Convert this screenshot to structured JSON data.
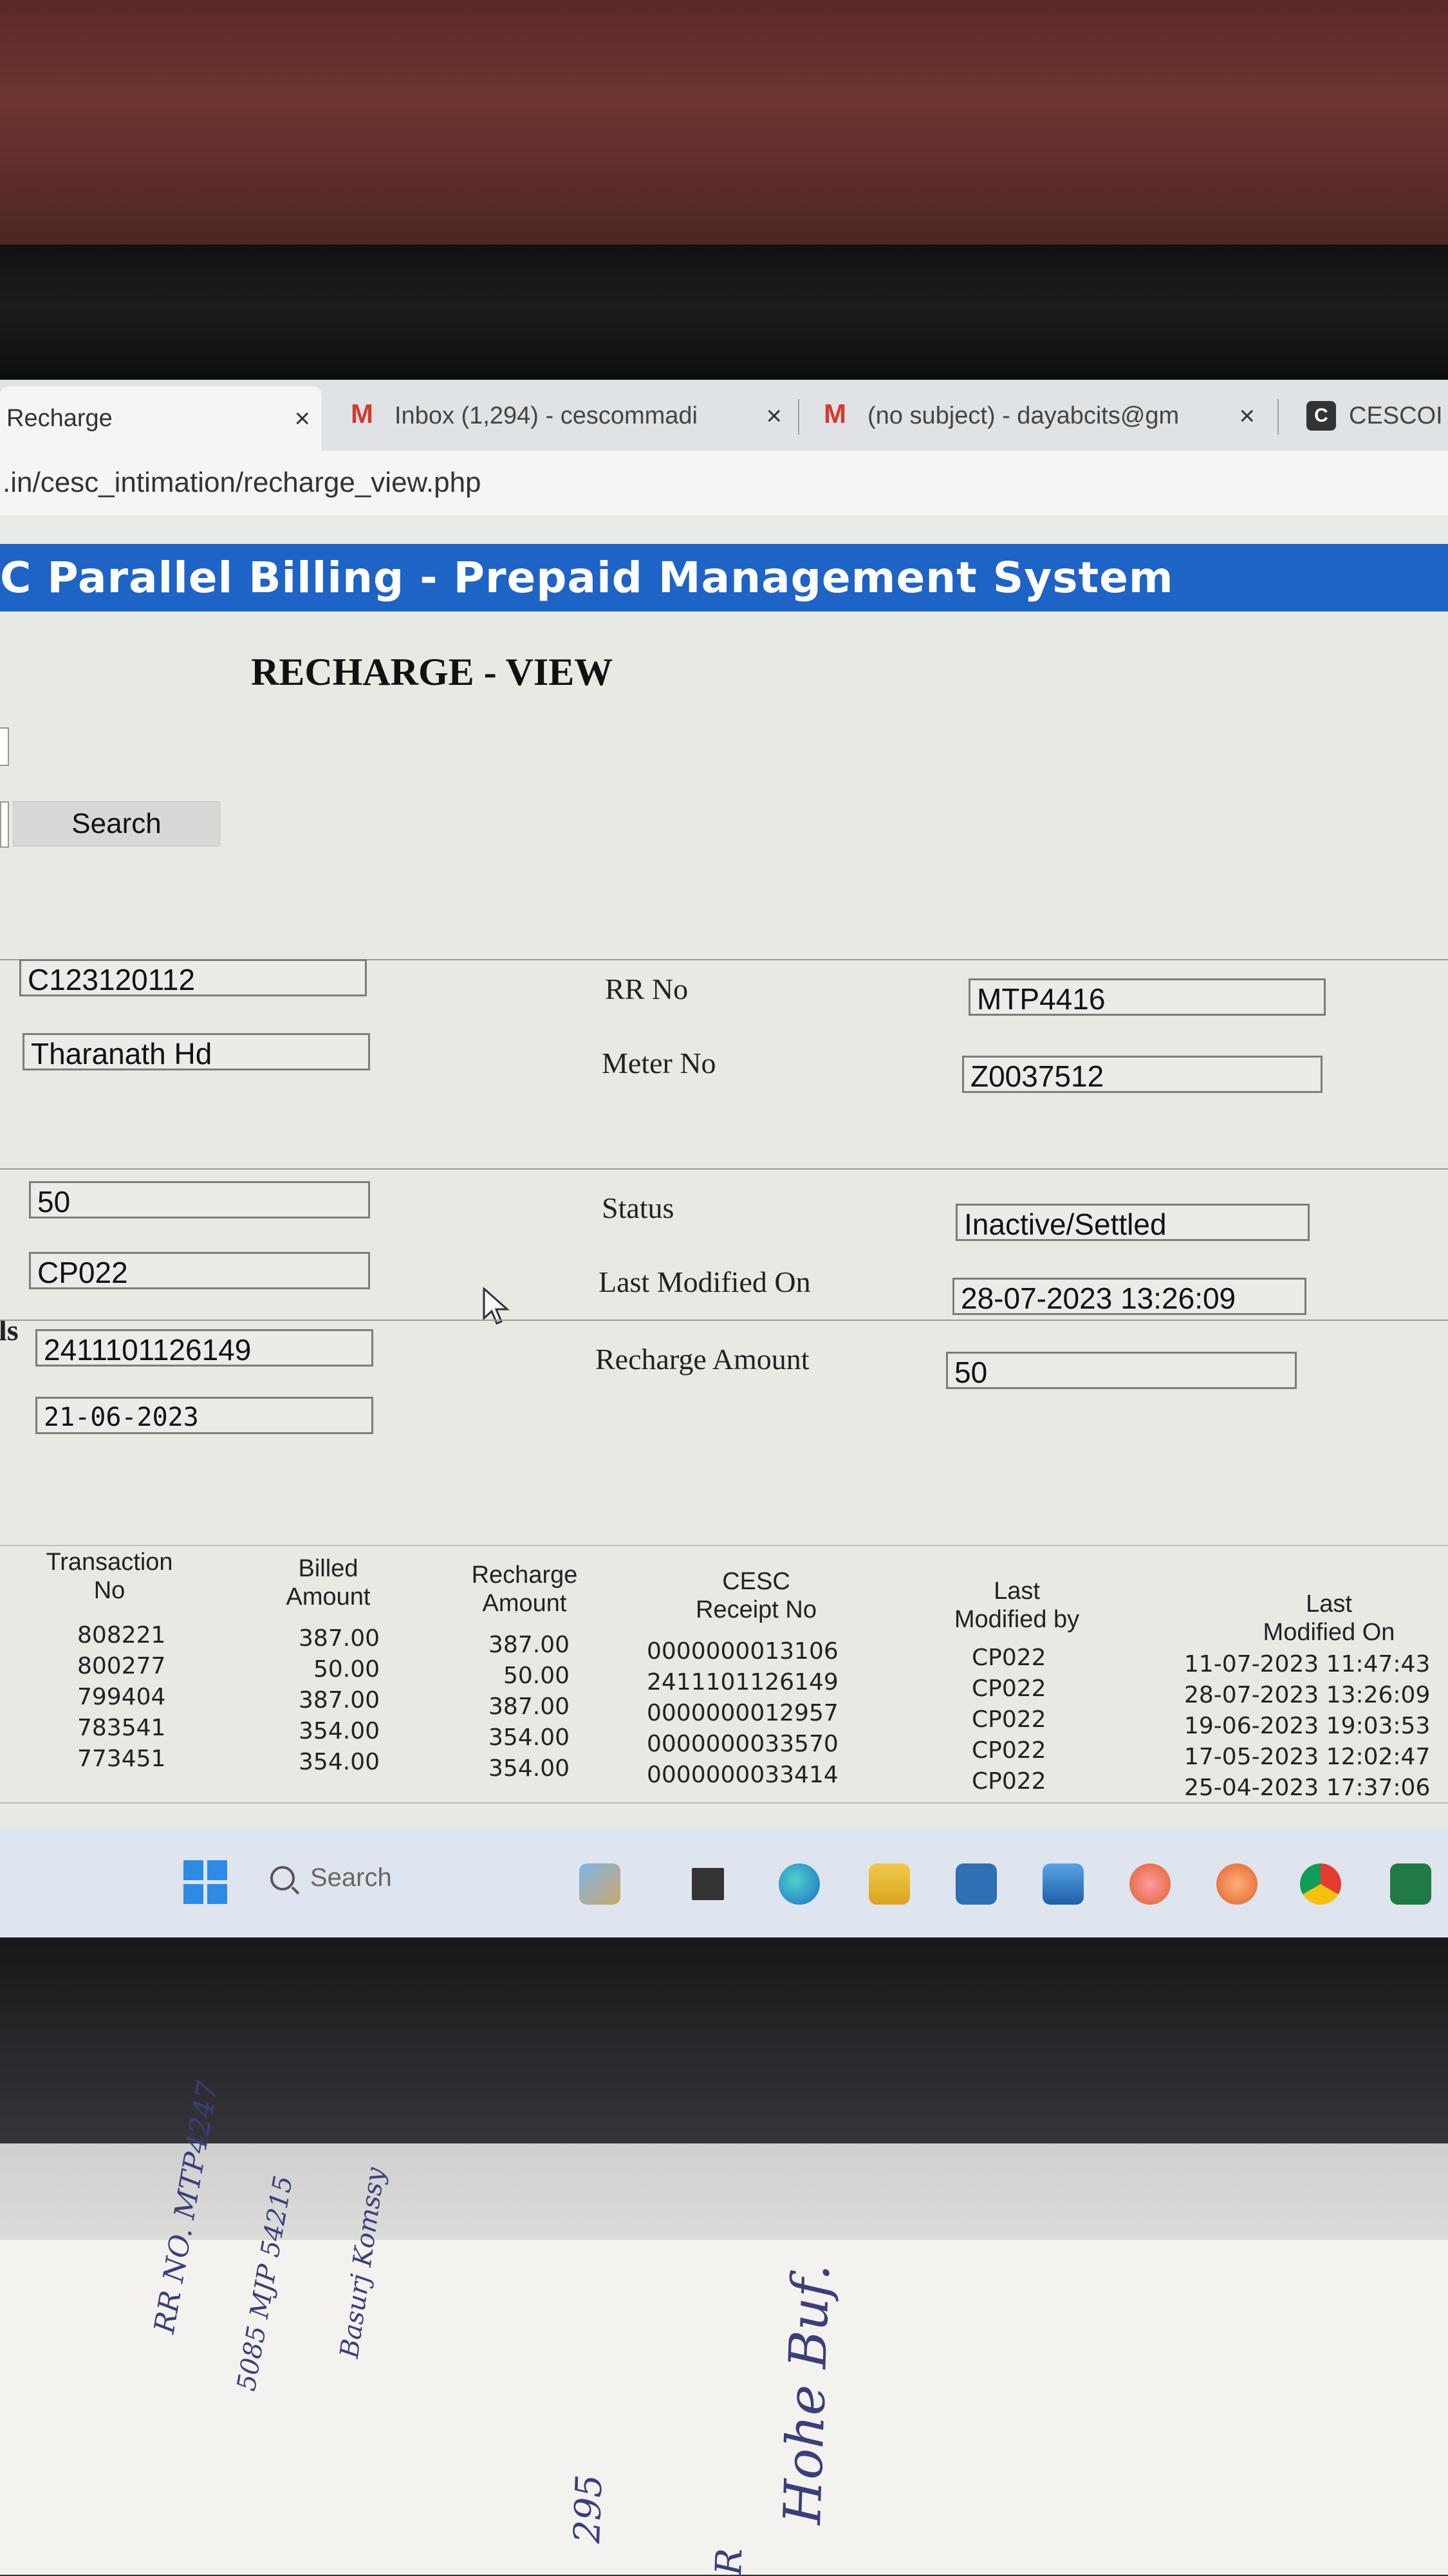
{
  "browser": {
    "tabs": [
      {
        "title": "Recharge",
        "close": "×"
      },
      {
        "title": "Inbox (1,294) - cescommadi",
        "close": "×"
      },
      {
        "title": "(no subject) - dayabcits@gm",
        "close": "×"
      },
      {
        "title": "CESCOI"
      }
    ],
    "favicon_letter": "C",
    "address": ".in/cesc_intimation/recharge_view.php"
  },
  "app": {
    "header": "C Parallel Billing - Prepaid Management System",
    "page_title": "RECHARGE - VIEW",
    "search_label": "Search",
    "section_marker": "ls"
  },
  "details": {
    "left": {
      "account_id": "C123120112",
      "name": "Tharanath Hd",
      "value_50": "50",
      "code": "CP022",
      "receipt_no": "2411101126149",
      "date": "21-06-2023"
    },
    "right": {
      "rr_no_label": "RR No",
      "rr_no": "MTP4416",
      "meter_no_label": "Meter No",
      "meter_no": "Z0037512",
      "status_label": "Status",
      "status": "Inactive/Settled",
      "last_modified_label": "Last Modified On",
      "last_modified": "28-07-2023 13:26:09",
      "recharge_amount_label": "Recharge Amount",
      "recharge_amount": "50"
    }
  },
  "table": {
    "headers": {
      "txn": [
        "Transaction",
        "No"
      ],
      "billed": [
        "Billed",
        "Amount"
      ],
      "recharge": [
        "Recharge",
        "Amount"
      ],
      "receipt": [
        "CESC",
        "Receipt No"
      ],
      "modified_by": [
        "Last",
        "Modified by"
      ],
      "modified_on": [
        "Last",
        "Modified On"
      ]
    },
    "rows": [
      {
        "txn": "808221",
        "billed": "387.00",
        "recharge": "387.00",
        "receipt": "0000000013106",
        "by": "CP022",
        "on": "11-07-2023 11:47:43"
      },
      {
        "txn": "800277",
        "billed": "50.00",
        "recharge": "50.00",
        "receipt": "2411101126149",
        "by": "CP022",
        "on": "28-07-2023 13:26:09"
      },
      {
        "txn": "799404",
        "billed": "387.00",
        "recharge": "387.00",
        "receipt": "0000000012957",
        "by": "CP022",
        "on": "19-06-2023 19:03:53"
      },
      {
        "txn": "783541",
        "billed": "354.00",
        "recharge": "354.00",
        "receipt": "0000000033570",
        "by": "CP022",
        "on": "17-05-2023 12:02:47"
      },
      {
        "txn": "773451",
        "billed": "354.00",
        "recharge": "354.00",
        "receipt": "0000000033414",
        "by": "CP022",
        "on": "25-04-2023 17:37:06"
      }
    ]
  },
  "taskbar": {
    "search_placeholder": "Search",
    "icons": [
      "start-icon",
      "search-icon",
      "widgets-icon",
      "file-explorer-icon",
      "edge-icon",
      "folder-icon",
      "store-icon",
      "mail-icon",
      "firefox-icon",
      "firefox-icon",
      "chrome-icon",
      "excel-icon"
    ]
  },
  "handwriting": [
    "RR NO. MTP4247",
    "5085 MJP 54215",
    "Basurj Komssy",
    "Hohe Buf.",
    "295",
    "R"
  ],
  "colors": {
    "header_blue": "#1e63c6",
    "taskbar": "#dfe5ee"
  }
}
